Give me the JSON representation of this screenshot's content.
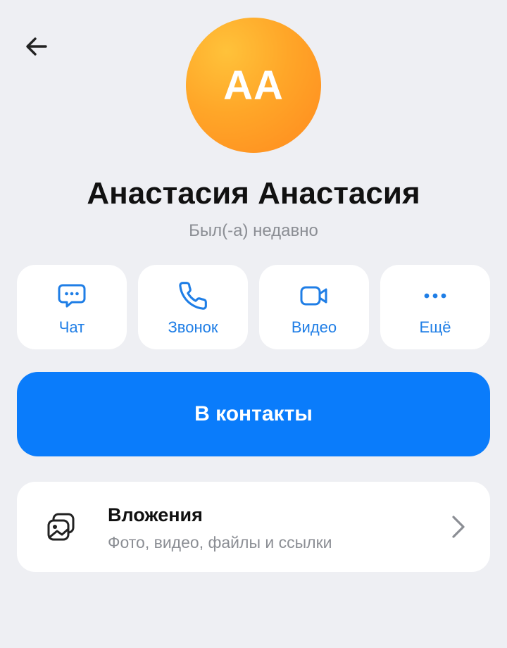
{
  "header": {
    "back_icon": "arrow-left-icon"
  },
  "profile": {
    "initials": "АА",
    "name": "Анастасия Анастасия",
    "status": "Был(-а) недавно",
    "avatar_color": "#ffa628"
  },
  "actions": [
    {
      "label": "Чат",
      "icon": "chat-icon"
    },
    {
      "label": "Звонок",
      "icon": "phone-icon"
    },
    {
      "label": "Видео",
      "icon": "video-icon"
    },
    {
      "label": "Ещё",
      "icon": "more-icon"
    }
  ],
  "primary": {
    "label": "В контакты",
    "color": "#0a7cfb"
  },
  "attachments": {
    "title": "Вложения",
    "subtitle": "Фото, видео, файлы и ссылки",
    "icon": "gallery-icon"
  },
  "colors": {
    "accent": "#1f7ee6",
    "background": "#eeeff3"
  }
}
